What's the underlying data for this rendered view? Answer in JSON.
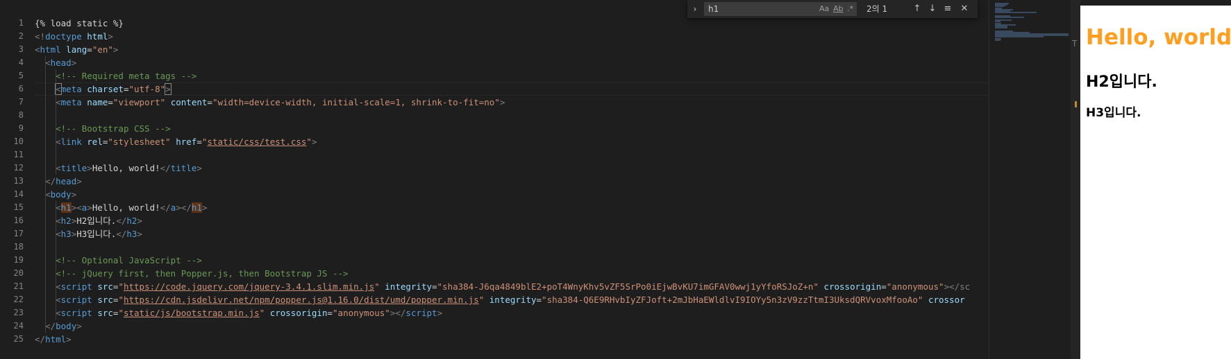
{
  "editor": {
    "line_numbers": [
      "1",
      "2",
      "3",
      "4",
      "5",
      "6",
      "7",
      "8",
      "9",
      "10",
      "11",
      "12",
      "13",
      "14",
      "15",
      "16",
      "17",
      "18",
      "19",
      "20",
      "21",
      "22",
      "23",
      "24",
      "25"
    ],
    "lines": {
      "l1": "{% load static %}",
      "l2_open": "<!",
      "l2_kw": "doctype",
      "l2_rest": " html",
      "l2_close": ">",
      "lt": "<",
      "gt": ">",
      "lts": "</",
      "eq": "=",
      "tag_html": "html",
      "tag_head": "head",
      "tag_meta": "meta",
      "tag_link": "link",
      "tag_title": "title",
      "tag_body": "body",
      "tag_h1": "h1",
      "tag_a": "a",
      "tag_h2": "h2",
      "tag_h3": "h3",
      "tag_script": "script",
      "attr_lang": "lang",
      "val_en": "\"en\"",
      "comment_meta": "<!-- Required meta tags -->",
      "attr_charset": "charset",
      "val_utf8": "\"utf-8\"",
      "attr_name": "name",
      "val_viewport": "\"viewport\"",
      "attr_content": "content",
      "val_content": "\"width=device-width, initial-scale=1, shrink-to-fit=no\"",
      "comment_bootstrap_css": "<!-- Bootstrap CSS -->",
      "attr_rel": "rel",
      "val_stylesheet": "\"stylesheet\"",
      "attr_href": "href",
      "val_href_q": "\"",
      "val_href": "static/css/test.css",
      "title_text": "Hello, world!",
      "a_text": "Hello, world!",
      "h2_text": "H2입니다.",
      "h3_text": "H3입니다.",
      "comment_optional_js": "<!-- Optional JavaScript -->",
      "comment_jquery": "<!-- jQuery first, then Popper.js, then Bootstrap JS -->",
      "attr_src": "src",
      "attr_integrity": "integrity",
      "attr_crossorigin": "crossorigin",
      "val_anonymous": "\"anonymous\"",
      "src21": "https://code.jquery.com/jquery-3.4.1.slim.min.js",
      "int21": "\"sha384-J6qa4849blE2+poT4WnyKhv5vZF5SrPo0iEjwBvKU7imGFAV0wwj1yYfoRSJoZ+n\"",
      "tail21": "</sc",
      "src22": "https://cdn.jsdelivr.net/npm/popper.js@1.16.0/dist/umd/popper.min.js",
      "int22": "\"sha384-Q6E9RHvbIyZFJoft+2mJbHaEWldlvI9IOYy5n3zV9zzTtmI3UksdQRVvoxMfooAo\"",
      "tail22": "crossor",
      "src23": "static/js/bootstrap.min.js"
    }
  },
  "find_widget": {
    "query": "h1",
    "match_case": "Aa",
    "whole_word": "Ab",
    "regex": ".*",
    "result_count": "2의 1",
    "toggle_icon": "chevron-right-icon",
    "prev_icon": "arrow-up-icon",
    "next_icon": "arrow-down-icon",
    "selection_icon": "lines-icon",
    "close_icon": "close-icon"
  },
  "preview": {
    "h1": "Hello, world!",
    "h2": "H2입니다.",
    "h3": "H3입니다.",
    "h1_color": "#ff9e1f"
  },
  "colors": {
    "editor_bg": "#1e1e1e",
    "tag": "#569cd6",
    "attribute": "#9cdcfe",
    "string": "#ce9178",
    "comment": "#6a9955",
    "find_highlight": "#613214"
  }
}
